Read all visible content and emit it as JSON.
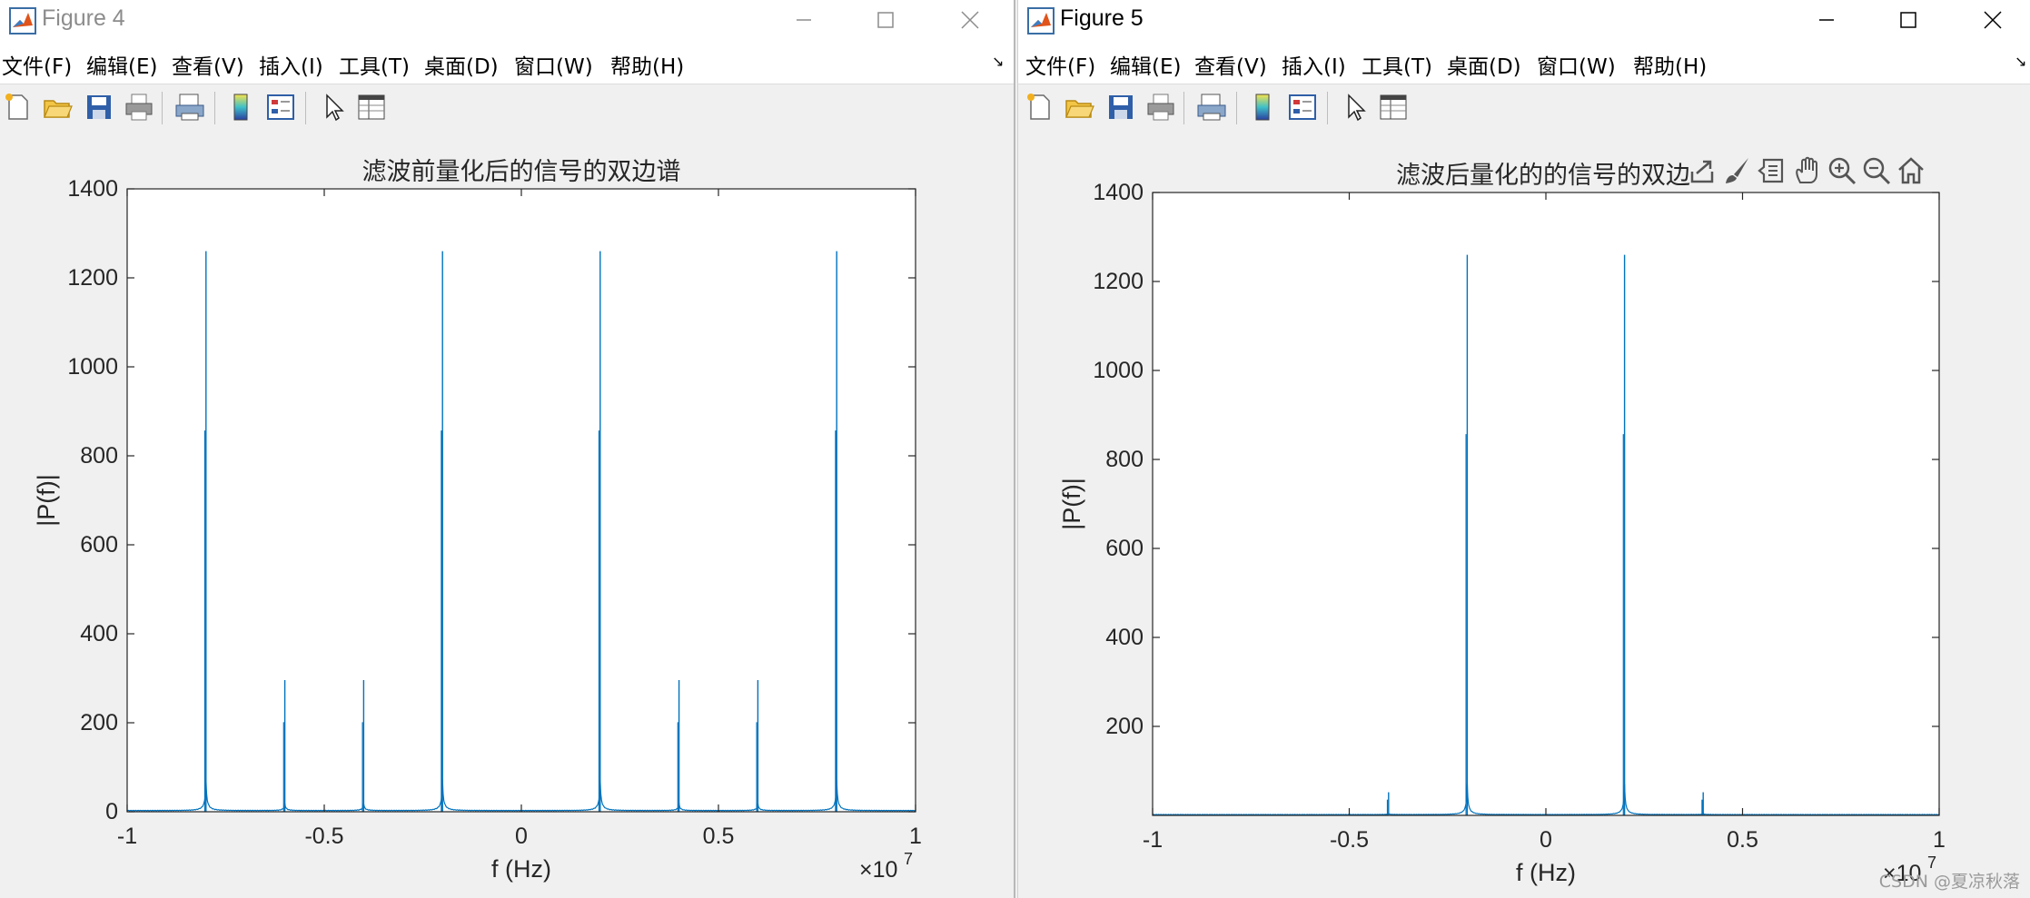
{
  "windows": [
    {
      "id": "win4",
      "title": "Figure 4",
      "menu": [
        "文件(F)",
        "编辑(E)",
        "查看(V)",
        "插入(I)",
        "工具(T)",
        "桌面(D)",
        "窗口(W)",
        "帮助(H)"
      ],
      "toolbar_icons": [
        "new-figure-icon",
        "open-file-icon",
        "save-icon",
        "print-icon",
        "print-preview-icon",
        "colorbar-icon",
        "legend-icon",
        "pointer-icon",
        "property-inspector-icon"
      ],
      "plot_title": "滤波前量化后的信号的双边谱",
      "xlabel": "f (Hz)",
      "ylabel": "|P(f)|",
      "exponent": "×10",
      "exponent_power": "7",
      "xticks": [
        "-1",
        "-0.5",
        "0",
        "0.5",
        "1"
      ],
      "yticks": [
        "0",
        "200",
        "400",
        "600",
        "800",
        "1000",
        "1200",
        "1400"
      ]
    },
    {
      "id": "win5",
      "title": "Figure 5",
      "menu": [
        "文件(F)",
        "编辑(E)",
        "查看(V)",
        "插入(I)",
        "工具(T)",
        "桌面(D)",
        "窗口(W)",
        "帮助(H)"
      ],
      "toolbar_icons": [
        "new-figure-icon",
        "open-file-icon",
        "save-icon",
        "print-icon",
        "print-preview-icon",
        "colorbar-icon",
        "legend-icon",
        "pointer-icon",
        "property-inspector-icon"
      ],
      "plot_title": "滤波后量化的的信号的双边",
      "xlabel": "f (Hz)",
      "ylabel": "|P(f)|",
      "exponent": "×10",
      "exponent_power": "7",
      "xticks": [
        "-1",
        "-0.5",
        "0",
        "0.5",
        "1"
      ],
      "yticks": [
        "200",
        "400",
        "600",
        "800",
        "1000",
        "1200",
        "1400"
      ],
      "axes_toolbar": [
        "export-icon",
        "brush-icon",
        "datatip-icon",
        "pan-icon",
        "zoom-in-icon",
        "zoom-out-icon",
        "home-icon"
      ]
    }
  ],
  "watermark": "CSDN @夏凉秋落",
  "colors": {
    "line": "#0072bd",
    "axes_bg": "#ffffff",
    "figure_bg": "#f0f0f0"
  },
  "chart_data": [
    {
      "type": "line",
      "title": "滤波前量化后的信号的双边谱",
      "xlabel": "f (Hz)",
      "ylabel": "|P(f)|",
      "x_scale": "×10^7",
      "xlim": [
        -10000000.0,
        10000000.0
      ],
      "ylim": [
        0,
        1400
      ],
      "peaks": [
        {
          "x": -8000000,
          "y": 1260
        },
        {
          "x": -6000000,
          "y": 296
        },
        {
          "x": -4000000,
          "y": 296
        },
        {
          "x": -2000000,
          "y": 1260
        },
        {
          "x": 2000000,
          "y": 1260
        },
        {
          "x": 4000000,
          "y": 296
        },
        {
          "x": 6000000,
          "y": 296
        },
        {
          "x": 8000000,
          "y": 1260
        }
      ],
      "noise_floor": 3
    },
    {
      "type": "line",
      "title": "滤波后量化的的信号的双边",
      "xlabel": "f (Hz)",
      "ylabel": "|P(f)|",
      "x_scale": "×10^7",
      "xlim": [
        -10000000.0,
        10000000.0
      ],
      "ylim": [
        0,
        1400
      ],
      "peaks": [
        {
          "x": -4000000,
          "y": 52
        },
        {
          "x": -2000000,
          "y": 1260
        },
        {
          "x": 2000000,
          "y": 1260
        },
        {
          "x": 4000000,
          "y": 52
        }
      ],
      "noise_floor": 2
    }
  ]
}
